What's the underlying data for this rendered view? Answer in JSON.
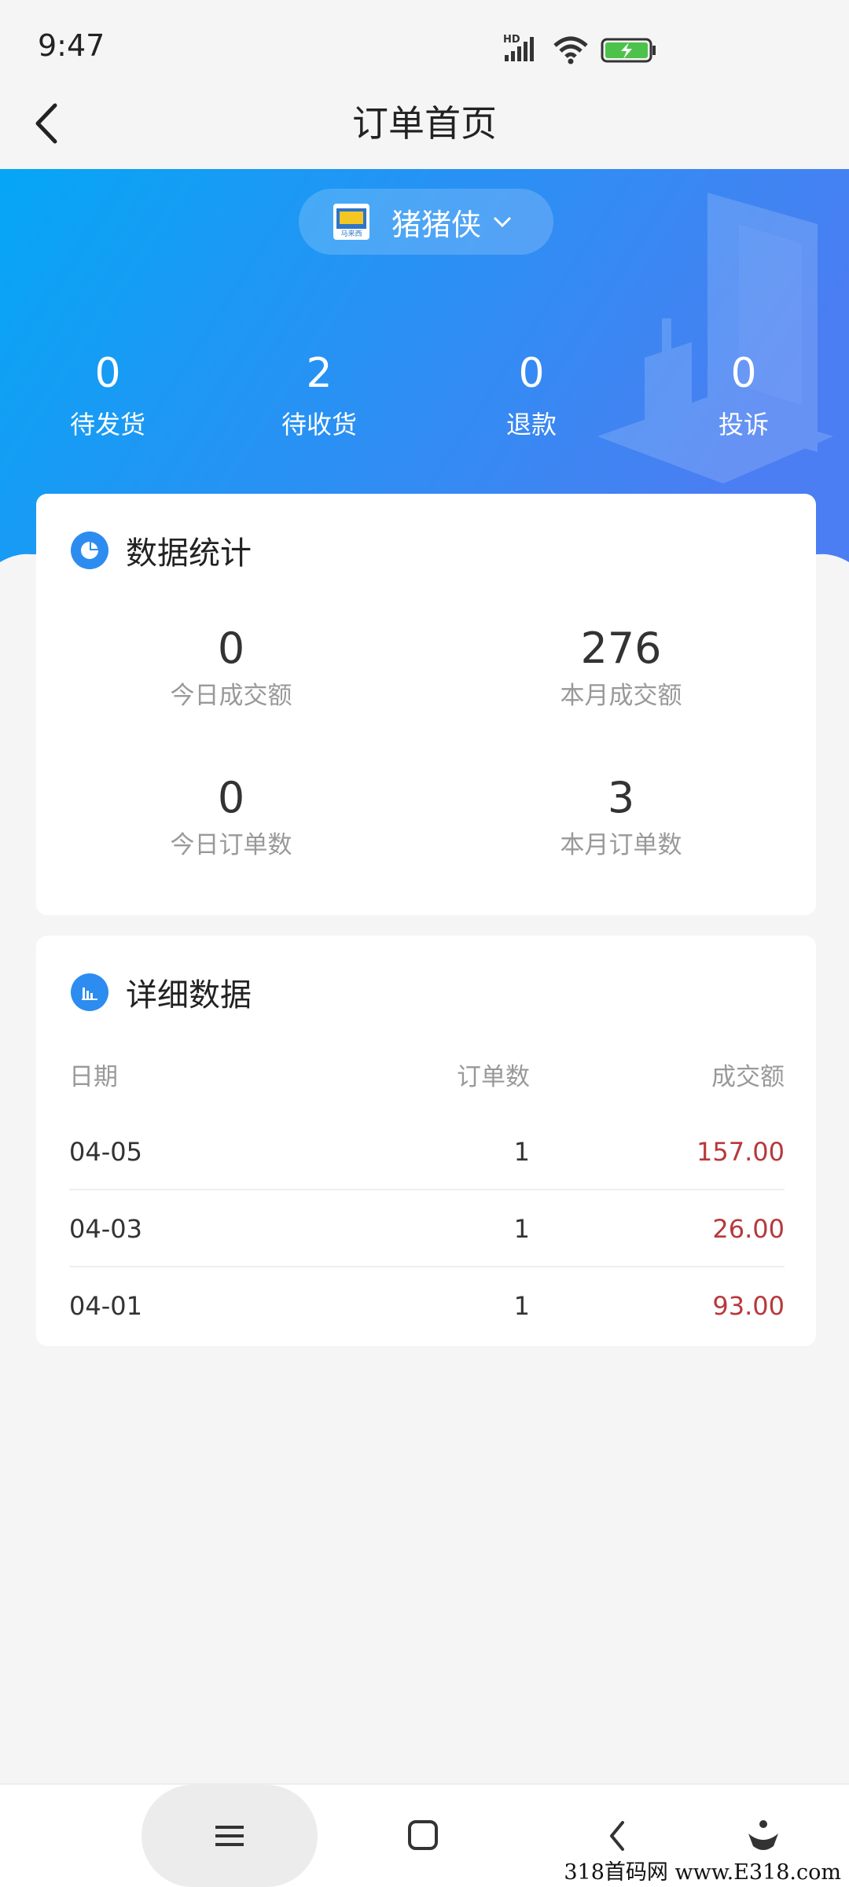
{
  "status_bar": {
    "time": "9:47",
    "net_badge": "HD"
  },
  "header": {
    "title": "订单首页"
  },
  "shop": {
    "name": "猪猪侠",
    "logo_text": "马来西"
  },
  "order_stats": [
    {
      "value": "0",
      "label": "待发货"
    },
    {
      "value": "2",
      "label": "待收货"
    },
    {
      "value": "0",
      "label": "退款"
    },
    {
      "value": "0",
      "label": "投诉"
    }
  ],
  "data_stats": {
    "title": "数据统计",
    "metrics": [
      {
        "value": "0",
        "label": "今日成交额"
      },
      {
        "value": "276",
        "label": "本月成交额"
      },
      {
        "value": "0",
        "label": "今日订单数"
      },
      {
        "value": "3",
        "label": "本月订单数"
      }
    ]
  },
  "detail": {
    "title": "详细数据",
    "columns": [
      "日期",
      "订单数",
      "成交额"
    ],
    "rows": [
      {
        "date": "04-05",
        "count": "1",
        "amount": "157.00"
      },
      {
        "date": "04-03",
        "count": "1",
        "amount": "26.00"
      },
      {
        "date": "04-01",
        "count": "1",
        "amount": "93.00"
      }
    ]
  },
  "watermark": "318首码网 www.E318.com",
  "colors": {
    "hero_start": "#05a6f5",
    "hero_end": "#4a7ef2",
    "amount": "#b8383b",
    "icon": "#2d8cf0"
  }
}
